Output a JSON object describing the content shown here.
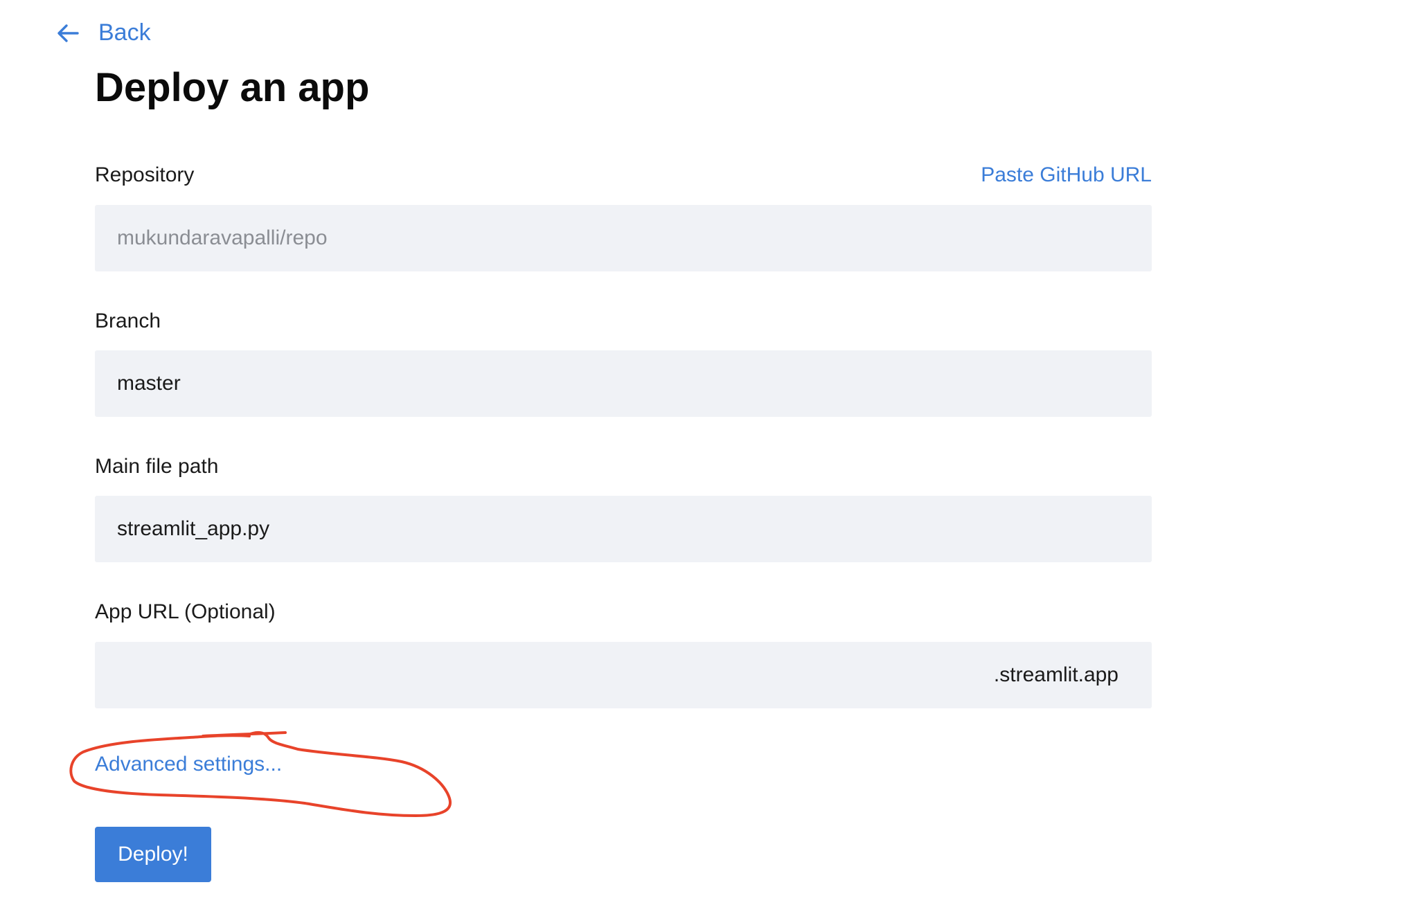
{
  "nav": {
    "back_label": "Back",
    "back_icon": "arrow-left-icon"
  },
  "page": {
    "title": "Deploy an app"
  },
  "form": {
    "repository": {
      "label": "Repository",
      "paste_link": "Paste GitHub URL",
      "placeholder": "mukundaravapalli/repo"
    },
    "branch": {
      "label": "Branch",
      "value": "master"
    },
    "main_file": {
      "label": "Main file path",
      "value": "streamlit_app.py"
    },
    "app_url": {
      "label": "App URL (Optional)",
      "value": "",
      "suffix": ".streamlit.app"
    },
    "advanced_label": "Advanced settings...",
    "deploy_label": "Deploy!"
  },
  "colors": {
    "accent": "#3b7dd8",
    "input_bg": "#f0f2f6",
    "annotation": "#e8432a"
  }
}
